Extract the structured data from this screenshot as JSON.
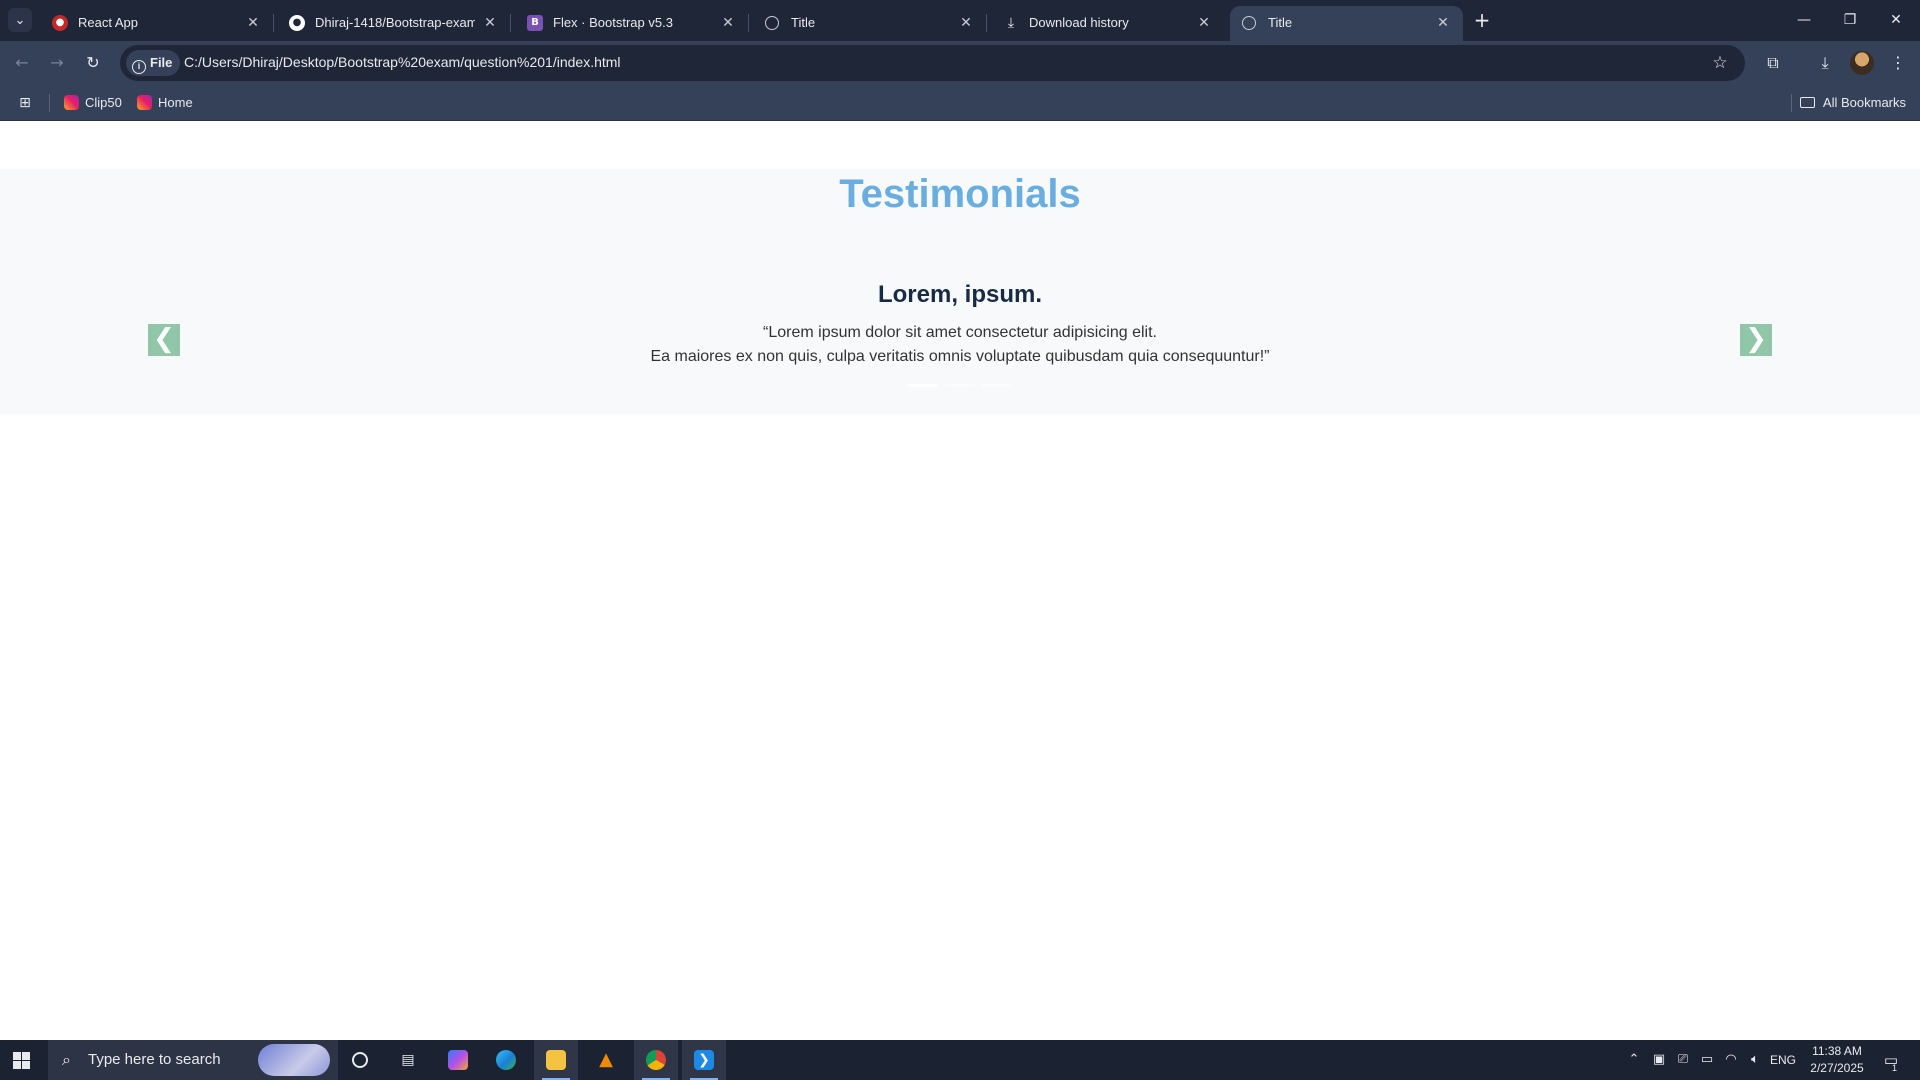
{
  "browser": {
    "tabs": [
      {
        "label": "React App",
        "icon": "react-app-favicon",
        "color": "#c62828",
        "active": false
      },
      {
        "label": "Dhiraj-1418/Bootstrap-exam",
        "icon": "github-icon",
        "color": "#ffffff",
        "active": false
      },
      {
        "label": "Flex · Bootstrap v5.3",
        "icon": "bootstrap-icon",
        "color": "#7952b3",
        "active": false
      },
      {
        "label": "Title",
        "icon": "globe-icon",
        "color": "#c7cbd3",
        "active": false
      },
      {
        "label": "Download history",
        "icon": "download-icon",
        "color": "#c7cbd3",
        "active": false
      },
      {
        "label": "Title",
        "icon": "globe-icon",
        "color": "#c7cbd3",
        "active": true
      }
    ],
    "address": {
      "chip_label": "File",
      "url": "C:/Users/Dhiraj/Desktop/Bootstrap%20exam/question%201/index.html"
    },
    "bookmarks": [
      {
        "label": "Clip50",
        "icon": "instagram-icon"
      },
      {
        "label": "Home",
        "icon": "instagram-icon"
      }
    ],
    "all_bookmarks_label": "All Bookmarks"
  },
  "page": {
    "section_title": "Testimonials",
    "slide": {
      "heading": "Lorem, ipsum.",
      "quote_line1": "“Lorem ipsum dolor sit amet consectetur adipisicing elit.",
      "quote_line2": "Ea maiores ex non quis, culpa veritatis omnis voluptate quibusdam quia consequuntur!”"
    },
    "indicators_count": 3,
    "active_indicator": 1,
    "colors": {
      "title": "#6aaee0",
      "heading": "#172b45",
      "section_bg": "#f8f9fa",
      "carousel_button": "#8fc7a8"
    }
  },
  "taskbar": {
    "search_placeholder": "Type here to search",
    "apps": [
      "cortana-icon",
      "task-view-icon",
      "copilot-icon",
      "edge-icon",
      "file-explorer-icon",
      "vlc-icon",
      "chrome-icon",
      "vscode-icon"
    ],
    "language": "ENG",
    "time": "11:38 AM",
    "date": "2/27/2025",
    "notification_count": "1"
  }
}
